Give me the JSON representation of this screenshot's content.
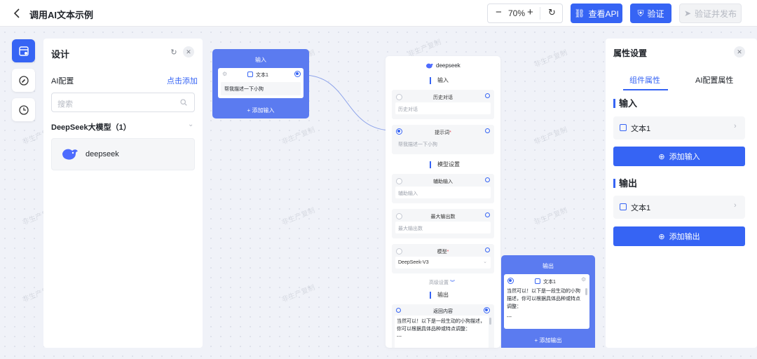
{
  "header": {
    "title": "调用AI文本示例",
    "zoom": "70%",
    "view_api": "查看API",
    "verify": "验证",
    "verify_publish": "验证并发布"
  },
  "left_panel": {
    "title": "设计",
    "ai_config": "AI配置",
    "add_link": "点击添加",
    "search_placeholder": "搜索",
    "group_title": "DeepSeek大模型（1）",
    "model_name": "deepseek"
  },
  "input_node": {
    "header": "输入",
    "field_label": "文本1",
    "field_value": "帮我描述一下小狗",
    "add": "添加输入"
  },
  "deepseek_node": {
    "title": "deepseek",
    "input_section": "输入",
    "history_label": "历史对话",
    "history_placeholder": "历史对话",
    "prompt_label": "提示词",
    "prompt_required": "*",
    "prompt_value": "帮我描述一下小狗",
    "model_settings": "模型设置",
    "aux_label": "辅助输入",
    "aux_placeholder": "辅助输入",
    "max_label": "最大输出数",
    "max_placeholder": "最大输出数",
    "model_label": "模型",
    "model_required": "*",
    "model_value": "DeepSeek-V3",
    "advanced": "高级设置",
    "output_section": "输出",
    "return_label": "返回内容",
    "return_value": "当然可以！以下是一段生动的小狗描述，你可以根据具体品种或特点调整：",
    "return_more": "---"
  },
  "output_node": {
    "header": "输出",
    "field_label": "文本1",
    "field_value": "当然可以！以下是一段生动的小狗描述，你可以根据具体品种或特点调整：",
    "field_more": "---",
    "add": "添加输出"
  },
  "right_panel": {
    "title": "属性设置",
    "tab_component": "组件属性",
    "tab_ai": "AI配置属性",
    "input_heading": "输入",
    "input_item": "文本1",
    "add_input": "添加输入",
    "output_heading": "输出",
    "output_item": "文本1",
    "add_output": "添加输出"
  },
  "watermark": "非生产复制",
  "colors": {
    "accent": "#3664f4",
    "node_header": "#5b7bf0"
  }
}
